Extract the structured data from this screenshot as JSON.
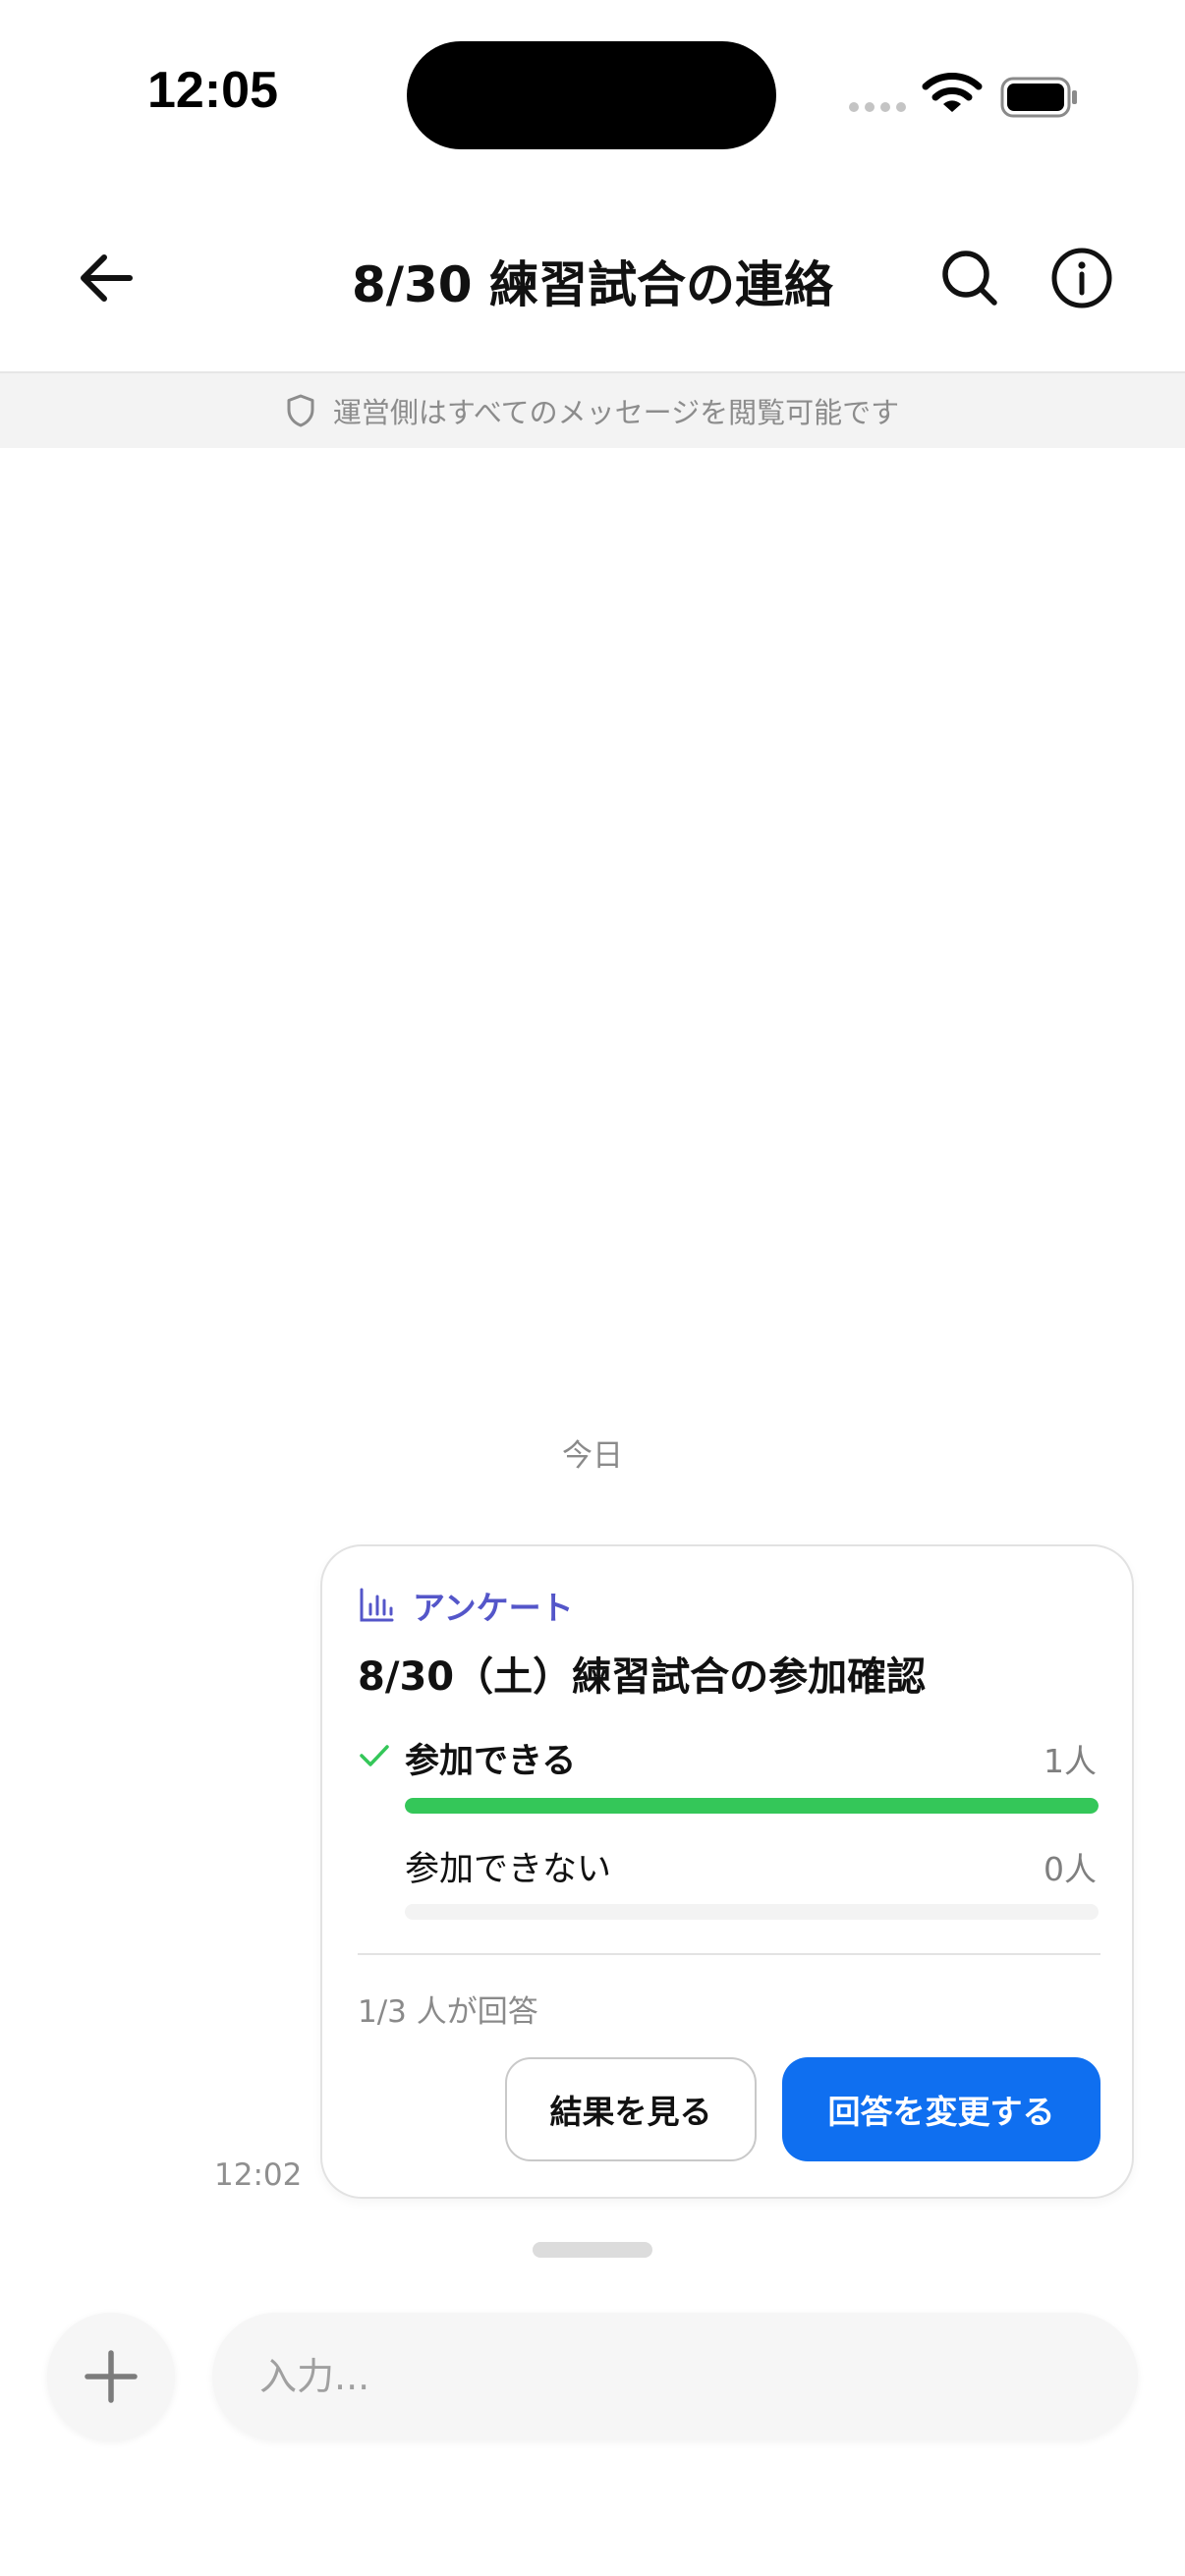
{
  "status_bar": {
    "time": "12:05",
    "wifi_icon": "wifi-icon",
    "battery_icon": "battery-icon"
  },
  "header": {
    "title": "8/30 練習試合の連絡",
    "back_icon": "arrow-left-icon",
    "search_icon": "search-icon",
    "info_icon": "info-icon"
  },
  "notice": {
    "icon": "shield-icon",
    "text": "運営側はすべてのメッセージを閲覧可能です"
  },
  "date_separator": "今日",
  "message": {
    "time": "12:02",
    "poll": {
      "kind_label": "アンケート",
      "kind_icon": "bar-chart-icon",
      "title": "8/30（土）練習試合の参加確認",
      "options": [
        {
          "label": "参加できる",
          "count": "1人",
          "selected": true,
          "share": 1.0
        },
        {
          "label": "参加できない",
          "count": "0人",
          "selected": false,
          "share": 0.0
        }
      ],
      "respondents": "1/3 人が回答",
      "view_results_label": "結果を見る",
      "change_answer_label": "回答を変更する"
    }
  },
  "composer": {
    "placeholder": "入力...",
    "add_icon": "plus-icon"
  },
  "colors": {
    "accent": "#0f6ff0",
    "poll_kind": "#5456c9",
    "bar_fill": "#34c759"
  }
}
